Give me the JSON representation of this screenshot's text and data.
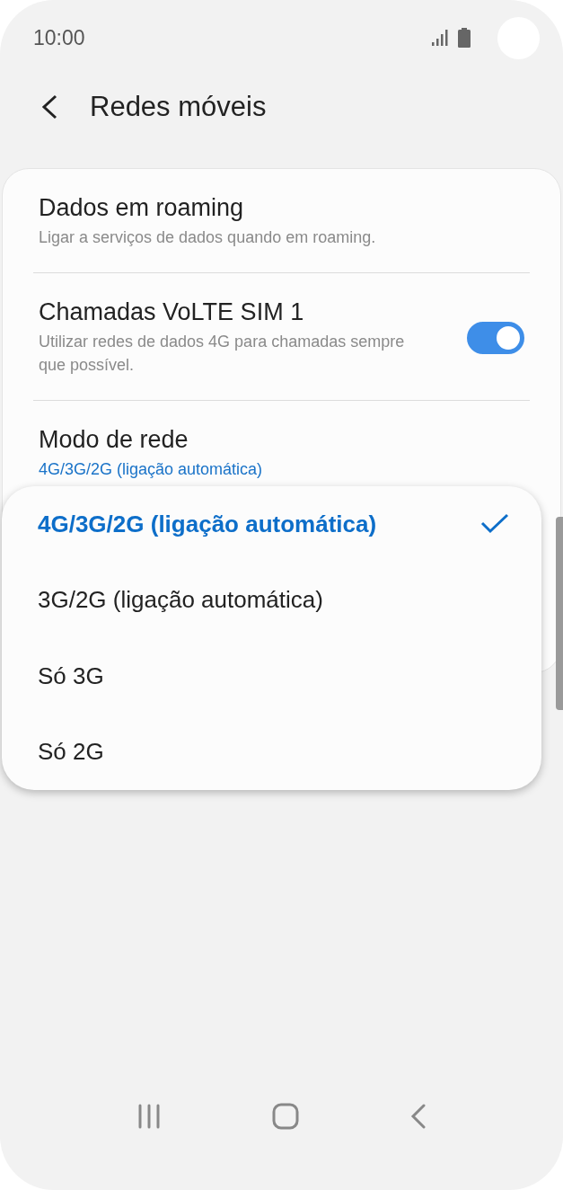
{
  "status_bar": {
    "time": "10:00"
  },
  "header": {
    "title": "Redes móveis"
  },
  "settings": [
    {
      "kind": "text",
      "title": "Dados em roaming",
      "subtitle": "Ligar a serviços de dados quando em roaming."
    },
    {
      "kind": "toggle",
      "title": "Chamadas VoLTE SIM 1",
      "subtitle": "Utilizar redes de dados 4G para chamadas sempre que possível.",
      "on": true
    },
    {
      "kind": "value",
      "title": "Modo de rede",
      "subtitle": "4G/3G/2G (ligação automática)"
    }
  ],
  "popup": {
    "options": [
      {
        "label": "4G/3G/2G (ligação automática)",
        "selected": true
      },
      {
        "label": "3G/2G (ligação automática)",
        "selected": false
      },
      {
        "label": "Só 3G",
        "selected": false
      },
      {
        "label": "Só 2G",
        "selected": false
      }
    ]
  }
}
